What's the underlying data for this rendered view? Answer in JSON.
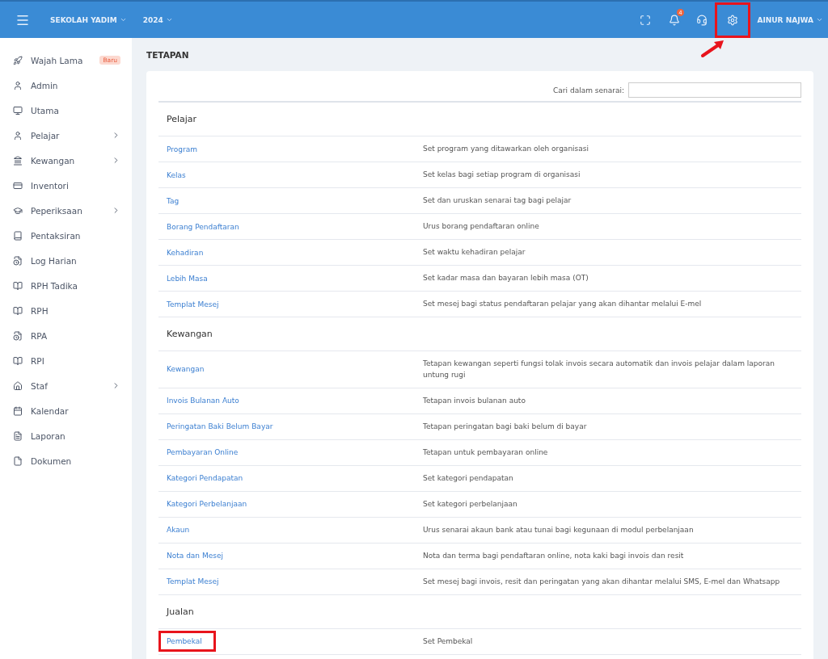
{
  "topbar": {
    "school": "SEKOLAH YADIM",
    "year": "2024",
    "notification_count": "4",
    "settings_highlighted": true,
    "user": "AINUR NAJWA"
  },
  "sidebar": {
    "items": [
      {
        "label": "Wajah Lama",
        "badge": "Baru",
        "has_submenu": false
      },
      {
        "label": "Admin",
        "has_submenu": false
      },
      {
        "label": "Utama",
        "has_submenu": false
      },
      {
        "label": "Pelajar",
        "has_submenu": true
      },
      {
        "label": "Kewangan",
        "has_submenu": true
      },
      {
        "label": "Inventori",
        "has_submenu": false
      },
      {
        "label": "Peperiksaan",
        "has_submenu": true
      },
      {
        "label": "Pentaksiran",
        "has_submenu": false
      },
      {
        "label": "Log Harian",
        "has_submenu": false
      },
      {
        "label": "RPH Tadika",
        "has_submenu": false
      },
      {
        "label": "RPH",
        "has_submenu": false
      },
      {
        "label": "RPA",
        "has_submenu": false
      },
      {
        "label": "RPI",
        "has_submenu": false
      },
      {
        "label": "Staf",
        "has_submenu": true
      },
      {
        "label": "Kalendar",
        "has_submenu": false
      },
      {
        "label": "Laporan",
        "has_submenu": false
      },
      {
        "label": "Dokumen",
        "has_submenu": false
      }
    ]
  },
  "page_title": "TETAPAN",
  "search": {
    "label": "Cari dalam senarai:"
  },
  "sections": [
    {
      "title": "Pelajar",
      "rows": [
        {
          "name": "Program",
          "description": "Set program yang ditawarkan oleh organisasi",
          "highlighted": false
        },
        {
          "name": "Kelas",
          "description": "Set kelas bagi setiap program di organisasi",
          "highlighted": false
        },
        {
          "name": "Tag",
          "description": "Set dan uruskan senarai tag bagi pelajar",
          "highlighted": false
        },
        {
          "name": "Borang Pendaftaran",
          "description": "Urus borang pendaftaran online",
          "highlighted": false
        },
        {
          "name": "Kehadiran",
          "description": "Set waktu kehadiran pelajar",
          "highlighted": false
        },
        {
          "name": "Lebih Masa",
          "description": "Set kadar masa dan bayaran lebih masa (OT)",
          "highlighted": false
        },
        {
          "name": "Templat Mesej",
          "description": "Set mesej bagi status pendaftaran pelajar yang akan dihantar melalui E-mel",
          "highlighted": false
        }
      ]
    },
    {
      "title": "Kewangan",
      "rows": [
        {
          "name": "Kewangan",
          "description": "Tetapan kewangan seperti fungsi tolak invois secara automatik dan invois pelajar dalam laporan untung rugi",
          "highlighted": false
        },
        {
          "name": "Invois Bulanan Auto",
          "description": "Tetapan invois bulanan auto",
          "highlighted": false
        },
        {
          "name": "Peringatan Baki Belum Bayar",
          "description": "Tetapan peringatan bagi baki belum di bayar",
          "highlighted": false
        },
        {
          "name": "Pembayaran Online",
          "description": "Tetapan untuk pembayaran online",
          "highlighted": false
        },
        {
          "name": "Kategori Pendapatan",
          "description": "Set kategori pendapatan",
          "highlighted": false
        },
        {
          "name": "Kategori Perbelanjaan",
          "description": "Set kategori perbelanjaan",
          "highlighted": false
        },
        {
          "name": "Akaun",
          "description": "Urus senarai akaun bank atau tunai bagi kegunaan di modul perbelanjaan",
          "highlighted": false
        },
        {
          "name": "Nota dan Mesej",
          "description": "Nota dan terma bagi pendaftaran online, nota kaki bagi invois dan resit",
          "highlighted": false
        },
        {
          "name": "Templat Mesej",
          "description": "Set mesej bagi invois, resit dan peringatan yang akan dihantar melalui SMS, E-mel dan Whatsapp",
          "highlighted": false
        }
      ]
    },
    {
      "title": "Jualan",
      "rows": [
        {
          "name": "Pembekal",
          "description": "Set Pembekal",
          "highlighted": true
        }
      ]
    }
  ]
}
